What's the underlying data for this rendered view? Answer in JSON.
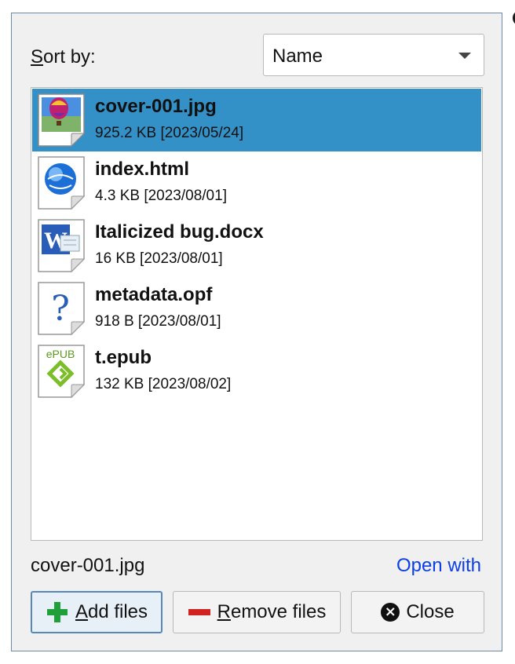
{
  "sort": {
    "label_first": "S",
    "label_rest": "ort by:",
    "selected": "Name"
  },
  "files": [
    {
      "name": "cover-001.jpg",
      "meta": "925.2 KB [2023/05/24]",
      "icon": "image-file-icon",
      "selected": true
    },
    {
      "name": "index.html",
      "meta": "4.3 KB [2023/08/01]",
      "icon": "html-file-icon",
      "selected": false
    },
    {
      "name": "Italicized bug.docx",
      "meta": "16 KB [2023/08/01]",
      "icon": "word-file-icon",
      "selected": false
    },
    {
      "name": "metadata.opf",
      "meta": "918 B [2023/08/01]",
      "icon": "unknown-file-icon",
      "selected": false
    },
    {
      "name": "t.epub",
      "meta": "132 KB [2023/08/02]",
      "icon": "epub-file-icon",
      "selected": false
    }
  ],
  "footer": {
    "current_file": "cover-001.jpg",
    "open_with": "Open with"
  },
  "buttons": {
    "add": {
      "first": "A",
      "rest": "dd files"
    },
    "remove": {
      "first": "R",
      "rest": "emove files"
    },
    "close": {
      "label": "Close"
    }
  },
  "icon_text": {
    "epub_tag": "ePUB",
    "unknown_glyph": "?",
    "word_letter": "W",
    "close_glyph": "×"
  },
  "colors": {
    "selection": "#3491c8",
    "link": "#0b3ee6",
    "add": "#1fa03a",
    "remove": "#d12222"
  }
}
